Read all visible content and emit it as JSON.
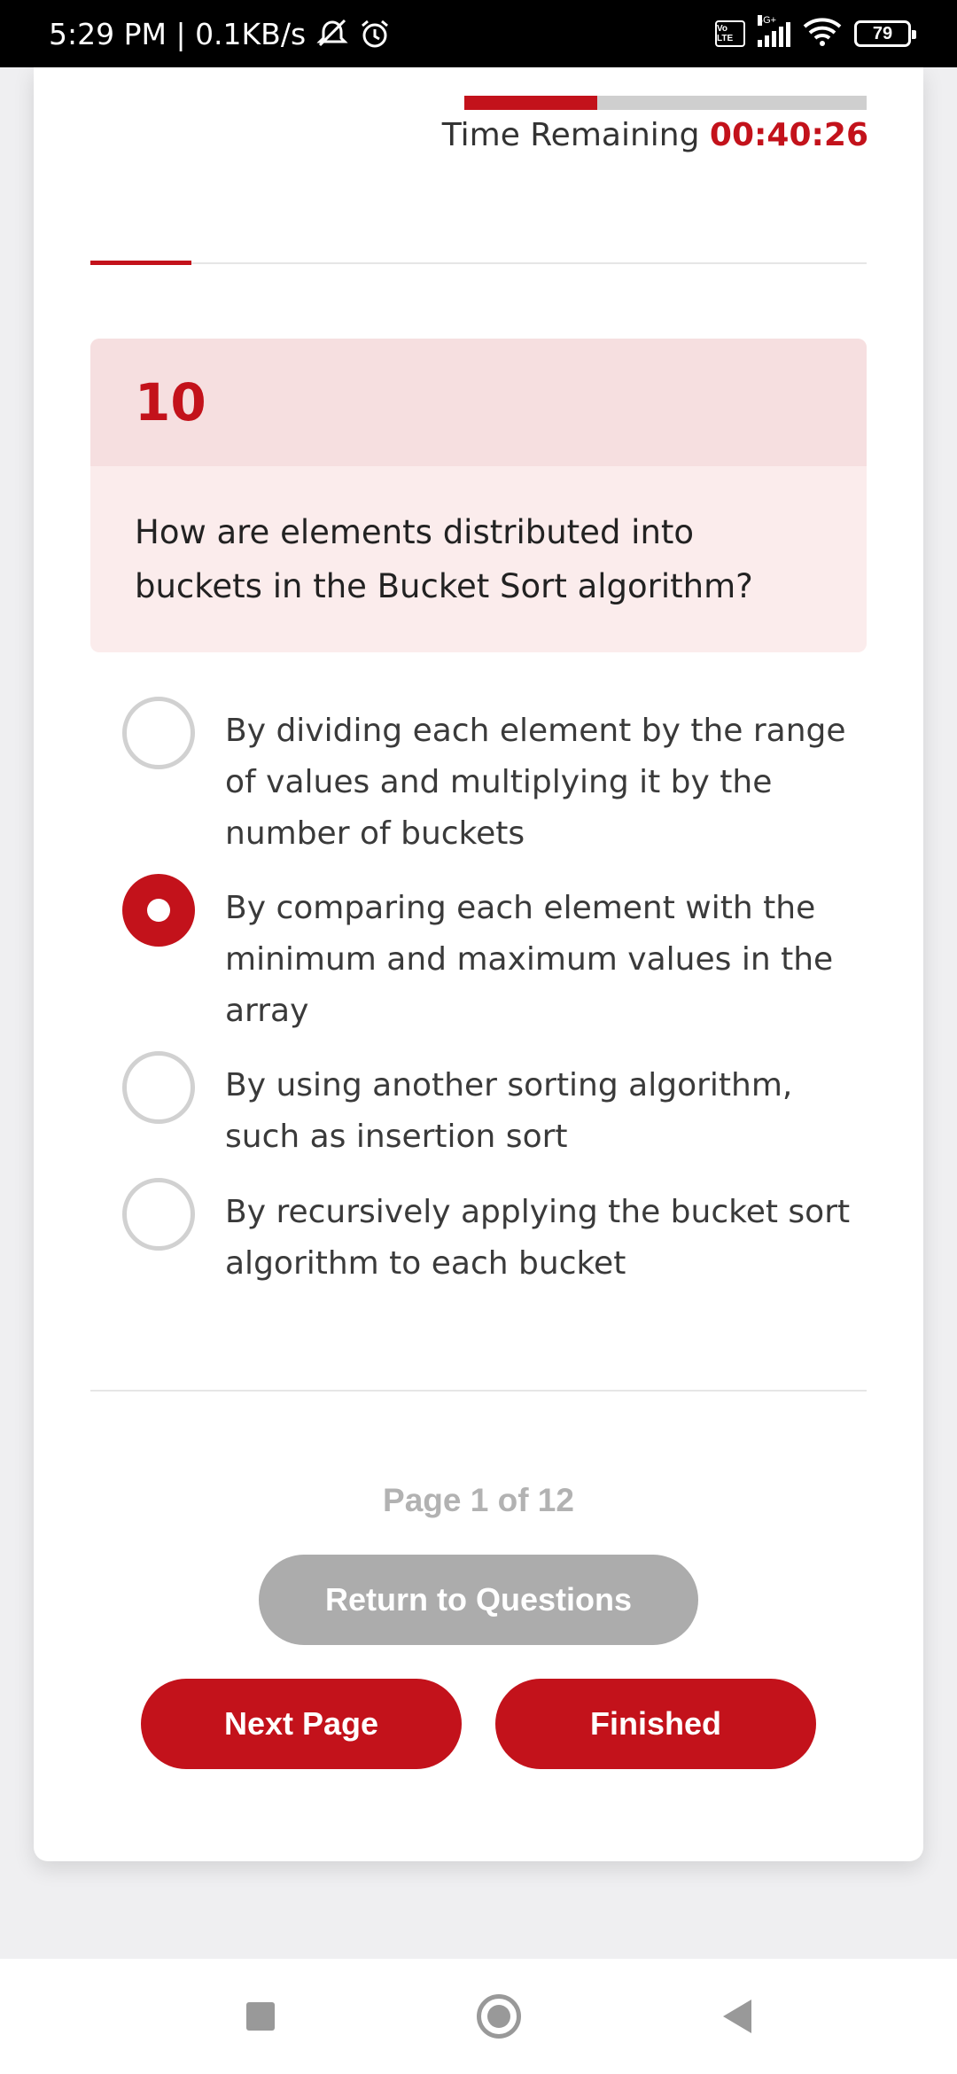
{
  "status_bar": {
    "time_network": "5:29 PM | 0.1KB/s",
    "volte_label": "Vo LTE",
    "network_type": "4G+",
    "battery": "79",
    "icons": [
      "alarm-off-icon",
      "alarm-icon",
      "signal-icon",
      "wifi-icon",
      "battery-icon"
    ]
  },
  "timer": {
    "label": "Time Remaining",
    "value": "00:40:26",
    "progress_fraction": 0.33
  },
  "section_progress_fraction": 0.13,
  "question": {
    "number": "10",
    "text": "How are elements distributed into buckets in the Bucket Sort algorithm?"
  },
  "options": [
    {
      "text": "By dividing each element by the range of values and multiplying it by the number of buckets",
      "selected": false
    },
    {
      "text": "By comparing each element with the minimum and maximum values in the array",
      "selected": true
    },
    {
      "text": "By using another sorting algorithm, such as insertion sort",
      "selected": false
    },
    {
      "text": "By recursively applying the bucket sort algorithm to each bucket",
      "selected": false
    }
  ],
  "pagination": {
    "page_info": "Page 1 of 12"
  },
  "buttons": {
    "return": "Return to Questions",
    "next": "Next Page",
    "finished": "Finished"
  },
  "colors": {
    "accent": "#c3121b",
    "question_header_bg": "#f6dfe0",
    "question_body_bg": "#fbecec",
    "disabled_button": "#acacac"
  }
}
